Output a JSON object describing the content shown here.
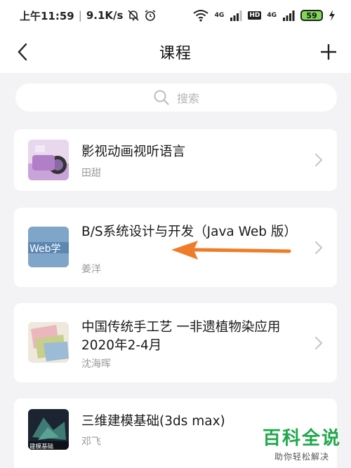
{
  "status_bar": {
    "time": "上午11:59",
    "separator": "|",
    "speed": "9.1K/s",
    "net1": "4G",
    "net2": "HD",
    "net3": "4G",
    "battery": "59"
  },
  "nav": {
    "title": "课程",
    "back_icon": "chevron-left-icon",
    "add_icon": "plus-icon"
  },
  "search": {
    "placeholder": "搜索"
  },
  "courses": [
    {
      "title": "影视动画视听语言",
      "teacher": "田甜"
    },
    {
      "title": "B/S系统设计与开发（Java Web 版）",
      "teacher": "姜洋",
      "thumb_text": "Web学"
    },
    {
      "title": "中国传统手工艺 一非遗植物染应用 2020年2-4月",
      "teacher": "沈海晖"
    },
    {
      "title": "三维建模基础(3ds max)",
      "teacher": "邓飞",
      "thumb_text": "建模基础"
    }
  ],
  "annotation": {
    "arrow_color": "#f07c2a"
  },
  "watermark": {
    "title": "百科全说",
    "subtitle": "助你轻松解决"
  },
  "colors": {
    "background": "#f3f3f5",
    "card": "#ffffff",
    "watermark_green": "#1fa84a"
  }
}
